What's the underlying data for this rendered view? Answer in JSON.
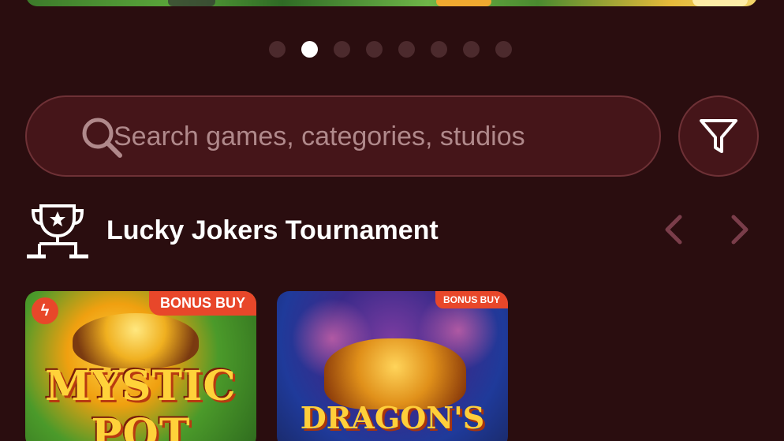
{
  "carousel": {
    "dot_count": 8,
    "active_index": 1
  },
  "search": {
    "placeholder": "Search games, categories, studios",
    "value": ""
  },
  "icons": {
    "search": "search-icon",
    "filter": "filter-icon",
    "trophy": "trophy-icon",
    "prev": "chevron-left-icon",
    "next": "chevron-right-icon"
  },
  "section": {
    "title": "Lucky Jokers Tournament"
  },
  "games": [
    {
      "title": "MYSTIC POT",
      "badge": "BONUS BUY"
    },
    {
      "title": "DRAGON'S",
      "badge": "BONUS BUY"
    }
  ],
  "colors": {
    "background": "#2a0d0f",
    "search_bg": "#451519",
    "accent_badge": "#e8472a",
    "dot_inactive": "#4c2a2d",
    "dot_active": "#ffffff"
  }
}
